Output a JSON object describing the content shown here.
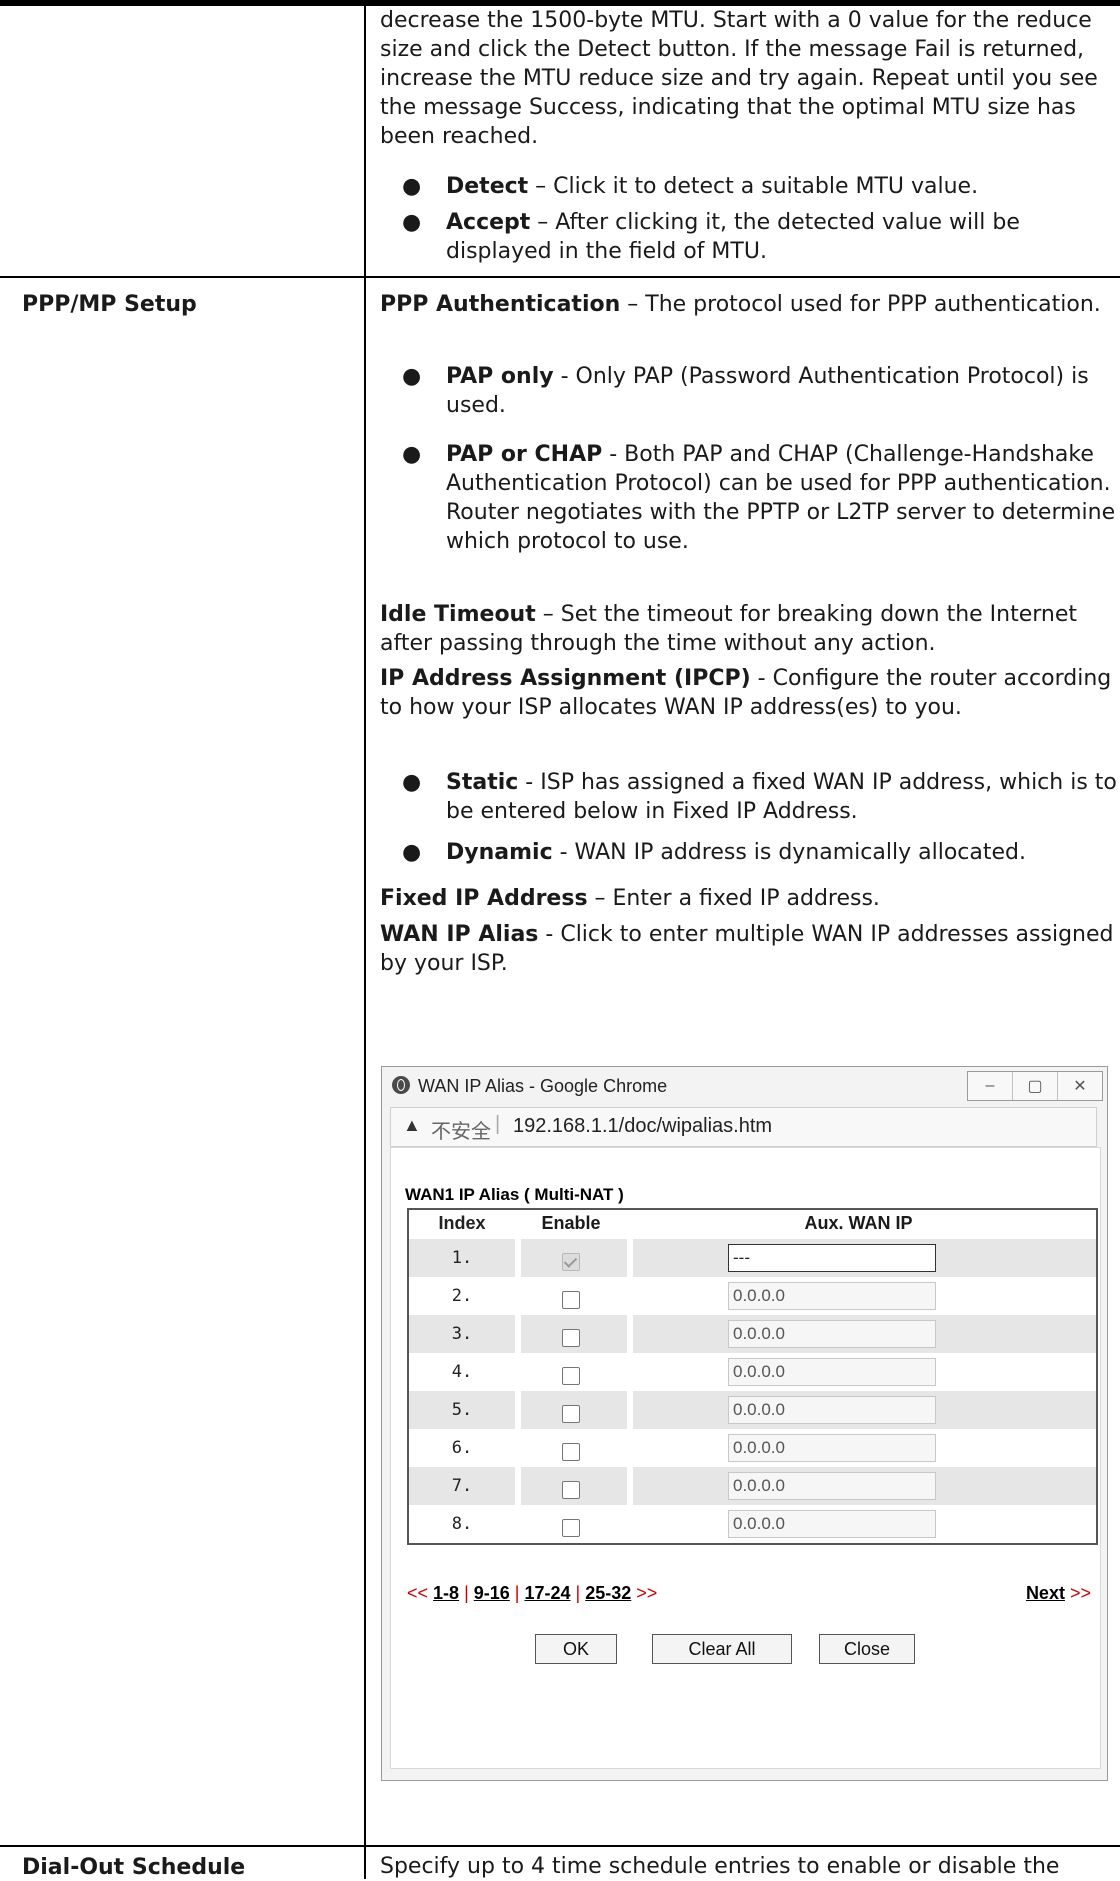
{
  "mtu_text_1": "decrease the 1500-byte MTU. Start with a 0 value for the reduce size and click the Detect button. If the message Fail is returned, increase the MTU reduce size and try again. Repeat until you see the message Success, indicating that the optimal MTU size has been reached.",
  "bullets_mtu": [
    {
      "term": "Detect",
      "desc": " – Click it to detect a suitable MTU value."
    },
    {
      "term": "Accept",
      "desc": " – After clicking it, the detected value will be displayed in the field of MTU."
    }
  ],
  "ppp_label": "PPP/MP Setup",
  "ppp_auth": {
    "term": "PPP Authentication",
    "desc": " – The protocol used for PPP authentication."
  },
  "bullets_auth": [
    {
      "term": "PAP only",
      "desc": " - Only PAP (Password Authentication Protocol) is used."
    },
    {
      "term": "PAP or CHAP",
      "desc": " - Both PAP and CHAP (Challenge-Handshake Authentication Protocol) can be used for PPP authentication. Router negotiates with the PPTP or L2TP server to determine which protocol to use."
    }
  ],
  "idle": {
    "term": "Idle Timeout",
    "desc": " – Set the timeout for breaking down the Internet after passing through the time without any action."
  },
  "ipcp": {
    "term": "IP Address Assignment (IPCP)",
    "desc": " - Configure the router according to how your ISP allocates WAN IP address(es) to you."
  },
  "bullets_ipcp": [
    {
      "term": "Static",
      "desc": " - ISP has assigned a fixed WAN IP address, which is to be entered below in Fixed IP Address."
    },
    {
      "term": "Dynamic",
      "desc": " - WAN IP address is dynamically allocated."
    }
  ],
  "fixed_ip": {
    "term": "Fixed IP Address",
    "desc": " – Enter a fixed IP address."
  },
  "wan_alias": {
    "term": "WAN IP Alias",
    "desc": " - Click to enter multiple WAN IP addresses assigned by your ISP."
  },
  "popup": {
    "title": "WAN IP Alias - Google Chrome",
    "insecure": "不安全",
    "url": "192.168.1.1/doc/wipalias.htm",
    "table_title": "WAN1  IP Alias ( Multi-NAT )",
    "headers": [
      "Index",
      "Enable",
      "Aux. WAN IP"
    ],
    "rows": [
      {
        "index": "1.",
        "enabled": true,
        "ip": "---"
      },
      {
        "index": "2.",
        "enabled": false,
        "ip": "0.0.0.0"
      },
      {
        "index": "3.",
        "enabled": false,
        "ip": "0.0.0.0"
      },
      {
        "index": "4.",
        "enabled": false,
        "ip": "0.0.0.0"
      },
      {
        "index": "5.",
        "enabled": false,
        "ip": "0.0.0.0"
      },
      {
        "index": "6.",
        "enabled": false,
        "ip": "0.0.0.0"
      },
      {
        "index": "7.",
        "enabled": false,
        "ip": "0.0.0.0"
      },
      {
        "index": "8.",
        "enabled": false,
        "ip": "0.0.0.0"
      }
    ],
    "pager_prev": "<<",
    "pages": [
      "1-8",
      "9-16",
      "17-24",
      "25-32"
    ],
    "pager_more": ">>",
    "next_label": "Next",
    "next_arrows": ">>",
    "buttons": {
      "ok": "OK",
      "clear": "Clear All",
      "close": "Close"
    }
  },
  "dial_label": "Dial-Out Schedule",
  "dial_text": "Specify up to 4 time schedule entries to enable or disable the"
}
